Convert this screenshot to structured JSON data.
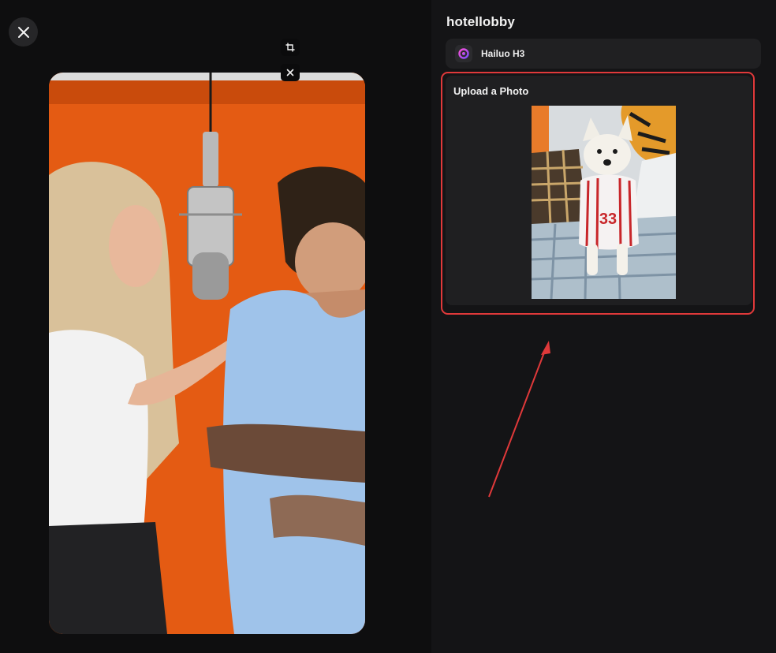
{
  "header": {
    "title": "hotellobby"
  },
  "model": {
    "label": "Hailuo H3",
    "icon": "hailuo-logo-icon"
  },
  "upload": {
    "title": "Upload a Photo",
    "jersey_number": "33"
  },
  "icons": {
    "close": "close-icon",
    "crop": "crop-icon",
    "remove": "x-icon"
  },
  "colors": {
    "highlight": "#e0393a",
    "accent_orange": "#e25a12",
    "model_icon_gradient_start": "#ff4fd8",
    "model_icon_gradient_end": "#7a4dff"
  }
}
